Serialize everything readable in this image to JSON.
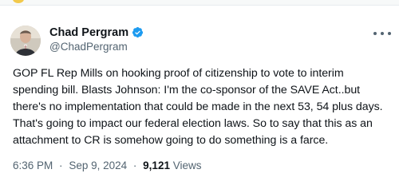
{
  "author": {
    "display_name": "Chad Pergram",
    "handle": "@ChadPergram",
    "verified": true,
    "verified_color": "#1d9bf0"
  },
  "tweet": {
    "text": "GOP FL Rep Mills on hooking proof of citizenship to vote to interim spending bill. Blasts Johnson: I'm the co-sponsor of the SAVE Act..but there's no implementation that could be made in the next 53, 54 plus days. That's going to impact our federal election laws. So to say that this as an attachment to CR is somehow going to do something is a farce."
  },
  "meta": {
    "time": "6:36 PM",
    "date": "Sep 9, 2024",
    "separator": "·",
    "views_count": "9,121",
    "views_label": "Views"
  },
  "icons": {
    "more": "more-options-icon",
    "verified": "verified-badge-icon"
  }
}
